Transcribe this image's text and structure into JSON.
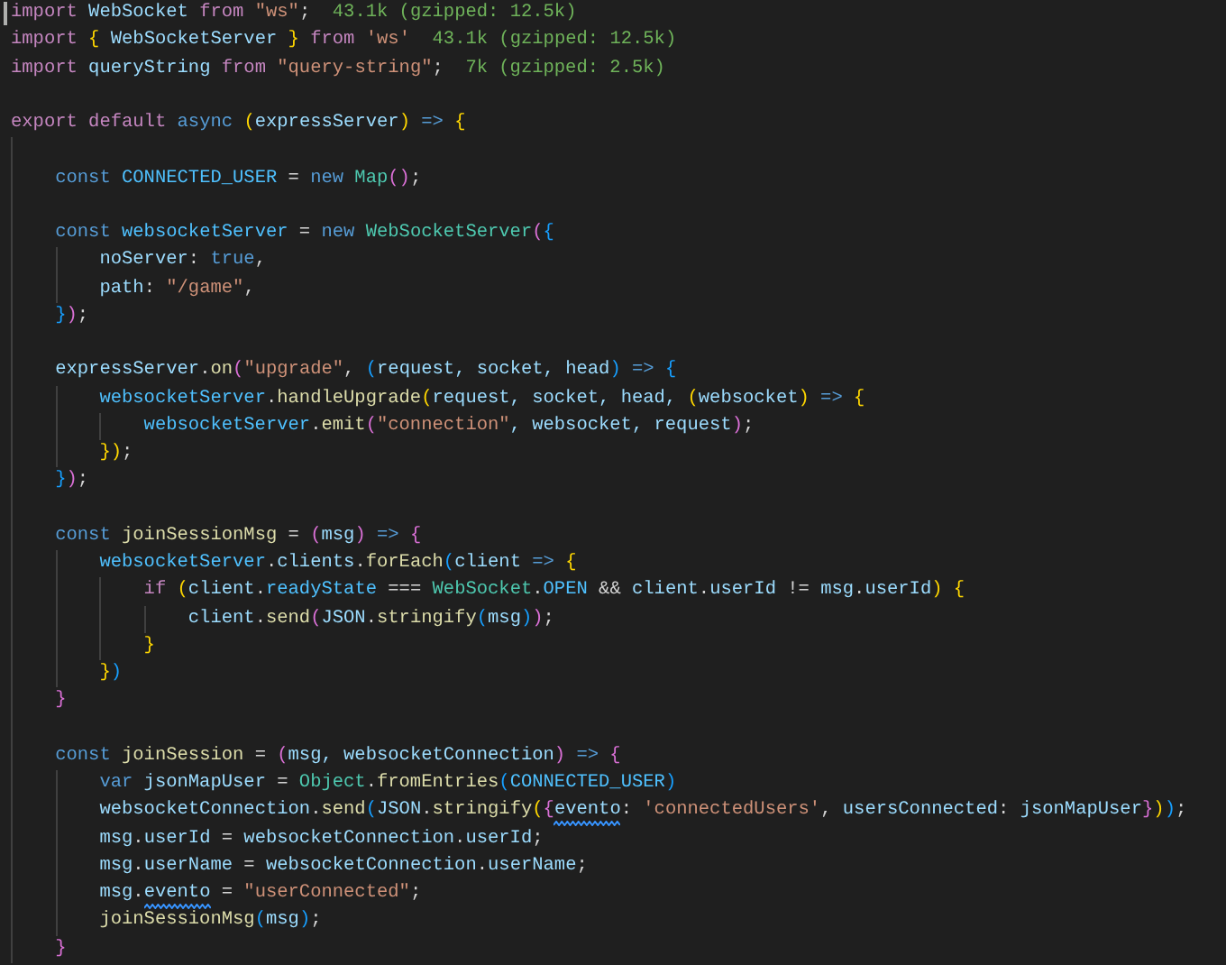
{
  "editor": {
    "cursor_at_start": true,
    "lines": [
      {
        "kind": "code",
        "tokens": [
          {
            "text": "import",
            "kind": "keyword"
          },
          {
            "text": " WebSocket ",
            "kind": "variable"
          },
          {
            "text": "from",
            "kind": "keyword"
          },
          {
            "text": " \"ws\"",
            "kind": "string"
          },
          {
            "text": ";",
            "kind": "plain"
          }
        ],
        "hint": "43.1k (gzipped: 12.5k)"
      },
      {
        "kind": "code",
        "tokens": [
          {
            "text": "import",
            "kind": "keyword"
          },
          {
            "text": " {",
            "kind": "bracket1"
          },
          {
            "text": " WebSocketServer ",
            "kind": "variable"
          },
          {
            "text": "}",
            "kind": "bracket1"
          },
          {
            "text": " from",
            "kind": "keyword"
          },
          {
            "text": " 'ws'",
            "kind": "string"
          }
        ],
        "hint": "43.1k (gzipped: 12.5k)"
      },
      {
        "kind": "code",
        "tokens": [
          {
            "text": "import",
            "kind": "keyword"
          },
          {
            "text": " queryString ",
            "kind": "variable"
          },
          {
            "text": "from",
            "kind": "keyword"
          },
          {
            "text": " \"query-string\"",
            "kind": "string"
          },
          {
            "text": ";",
            "kind": "plain"
          }
        ],
        "hint": "7k (gzipped: 2.5k)"
      },
      {
        "kind": "blank"
      },
      {
        "kind": "code",
        "tokens": [
          {
            "text": "export default",
            "kind": "keyword"
          },
          {
            "text": " async ",
            "kind": "storage"
          },
          {
            "text": "(",
            "kind": "bracket1"
          },
          {
            "text": "expressServer",
            "kind": "variable"
          },
          {
            "text": ")",
            "kind": "bracket1"
          },
          {
            "text": " =>",
            "kind": "storage"
          },
          {
            "text": " {",
            "kind": "bracket1"
          }
        ]
      },
      {
        "kind": "blank"
      },
      {
        "kind": "code",
        "tokens": [
          {
            "text": "    const",
            "kind": "storage"
          },
          {
            "text": " CONNECTED_USER",
            "kind": "constant"
          },
          {
            "text": " = ",
            "kind": "plain"
          },
          {
            "text": "new",
            "kind": "storage"
          },
          {
            "text": " Map",
            "kind": "type"
          },
          {
            "text": "()",
            "kind": "bracket2"
          },
          {
            "text": ";",
            "kind": "plain"
          }
        ]
      },
      {
        "kind": "blank"
      },
      {
        "kind": "code",
        "tokens": [
          {
            "text": "    const",
            "kind": "storage"
          },
          {
            "text": " websocketServer",
            "kind": "constant"
          },
          {
            "text": " = ",
            "kind": "plain"
          },
          {
            "text": "new",
            "kind": "storage"
          },
          {
            "text": " WebSocketServer",
            "kind": "type"
          },
          {
            "text": "(",
            "kind": "bracket2"
          },
          {
            "text": "{",
            "kind": "bracket3"
          }
        ]
      },
      {
        "kind": "code",
        "tokens": [
          {
            "text": "        noServer",
            "kind": "variable"
          },
          {
            "text": ": ",
            "kind": "plain"
          },
          {
            "text": "true",
            "kind": "storage"
          },
          {
            "text": ",",
            "kind": "plain"
          }
        ]
      },
      {
        "kind": "code",
        "tokens": [
          {
            "text": "        path",
            "kind": "variable"
          },
          {
            "text": ": ",
            "kind": "plain"
          },
          {
            "text": "\"/game\"",
            "kind": "string"
          },
          {
            "text": ",",
            "kind": "plain"
          }
        ]
      },
      {
        "kind": "code",
        "tokens": [
          {
            "text": "    }",
            "kind": "bracket3"
          },
          {
            "text": ")",
            "kind": "bracket2"
          },
          {
            "text": ";",
            "kind": "plain"
          }
        ]
      },
      {
        "kind": "blank"
      },
      {
        "kind": "code",
        "tokens": [
          {
            "text": "    expressServer",
            "kind": "variable"
          },
          {
            "text": ".",
            "kind": "plain"
          },
          {
            "text": "on",
            "kind": "function"
          },
          {
            "text": "(",
            "kind": "bracket2"
          },
          {
            "text": "\"upgrade\"",
            "kind": "string"
          },
          {
            "text": ", ",
            "kind": "plain"
          },
          {
            "text": "(",
            "kind": "bracket3"
          },
          {
            "text": "request, socket, head",
            "kind": "variable"
          },
          {
            "text": ")",
            "kind": "bracket3"
          },
          {
            "text": " => ",
            "kind": "storage"
          },
          {
            "text": "{",
            "kind": "bracket3"
          }
        ]
      },
      {
        "kind": "code",
        "tokens": [
          {
            "text": "        websocketServer",
            "kind": "constant"
          },
          {
            "text": ".",
            "kind": "plain"
          },
          {
            "text": "handleUpgrade",
            "kind": "function"
          },
          {
            "text": "(",
            "kind": "bracket1"
          },
          {
            "text": "request, socket, head, ",
            "kind": "variable"
          },
          {
            "text": "(",
            "kind": "bracket1"
          },
          {
            "text": "websocket",
            "kind": "variable"
          },
          {
            "text": ")",
            "kind": "bracket1"
          },
          {
            "text": " => ",
            "kind": "storage"
          },
          {
            "text": "{",
            "kind": "bracket1"
          }
        ]
      },
      {
        "kind": "code",
        "tokens": [
          {
            "text": "            websocketServer",
            "kind": "constant"
          },
          {
            "text": ".",
            "kind": "plain"
          },
          {
            "text": "emit",
            "kind": "function"
          },
          {
            "text": "(",
            "kind": "bracket2"
          },
          {
            "text": "\"connection\"",
            "kind": "string"
          },
          {
            "text": ", websocket, request",
            "kind": "variable"
          },
          {
            "text": ")",
            "kind": "bracket2"
          },
          {
            "text": ";",
            "kind": "plain"
          }
        ]
      },
      {
        "kind": "code",
        "tokens": [
          {
            "text": "        })",
            "kind": "bracket1"
          },
          {
            "text": ";",
            "kind": "plain"
          }
        ]
      },
      {
        "kind": "code",
        "tokens": [
          {
            "text": "    }",
            "kind": "bracket3"
          },
          {
            "text": ")",
            "kind": "bracket2"
          },
          {
            "text": ";",
            "kind": "plain"
          }
        ]
      },
      {
        "kind": "blank"
      },
      {
        "kind": "code",
        "tokens": [
          {
            "text": "    const",
            "kind": "storage"
          },
          {
            "text": " joinSessionMsg",
            "kind": "function"
          },
          {
            "text": " = ",
            "kind": "plain"
          },
          {
            "text": "(",
            "kind": "bracket2"
          },
          {
            "text": "msg",
            "kind": "variable"
          },
          {
            "text": ")",
            "kind": "bracket2"
          },
          {
            "text": " => ",
            "kind": "storage"
          },
          {
            "text": "{",
            "kind": "bracket2"
          }
        ]
      },
      {
        "kind": "code",
        "tokens": [
          {
            "text": "        websocketServer",
            "kind": "constant"
          },
          {
            "text": ".",
            "kind": "plain"
          },
          {
            "text": "clients",
            "kind": "variable"
          },
          {
            "text": ".",
            "kind": "plain"
          },
          {
            "text": "forEach",
            "kind": "function"
          },
          {
            "text": "(",
            "kind": "bracket3"
          },
          {
            "text": "client",
            "kind": "variable"
          },
          {
            "text": " => ",
            "kind": "storage"
          },
          {
            "text": "{",
            "kind": "bracket1"
          }
        ]
      },
      {
        "kind": "code",
        "tokens": [
          {
            "text": "            if",
            "kind": "keyword"
          },
          {
            "text": " (",
            "kind": "bracket1"
          },
          {
            "text": "client",
            "kind": "variable"
          },
          {
            "text": ".",
            "kind": "plain"
          },
          {
            "text": "readyState",
            "kind": "constant"
          },
          {
            "text": " === ",
            "kind": "plain"
          },
          {
            "text": "WebSocket",
            "kind": "type"
          },
          {
            "text": ".",
            "kind": "plain"
          },
          {
            "text": "OPEN",
            "kind": "constant"
          },
          {
            "text": " && ",
            "kind": "plain"
          },
          {
            "text": "client",
            "kind": "variable"
          },
          {
            "text": ".",
            "kind": "plain"
          },
          {
            "text": "userId",
            "kind": "variable"
          },
          {
            "text": " != ",
            "kind": "plain"
          },
          {
            "text": "msg",
            "kind": "variable"
          },
          {
            "text": ".",
            "kind": "plain"
          },
          {
            "text": "userId",
            "kind": "variable"
          },
          {
            "text": ")",
            "kind": "bracket1"
          },
          {
            "text": " {",
            "kind": "bracket1"
          }
        ]
      },
      {
        "kind": "code",
        "tokens": [
          {
            "text": "                client",
            "kind": "variable"
          },
          {
            "text": ".",
            "kind": "plain"
          },
          {
            "text": "send",
            "kind": "function"
          },
          {
            "text": "(",
            "kind": "bracket2"
          },
          {
            "text": "JSON",
            "kind": "variable"
          },
          {
            "text": ".",
            "kind": "plain"
          },
          {
            "text": "stringify",
            "kind": "function"
          },
          {
            "text": "(",
            "kind": "bracket3"
          },
          {
            "text": "msg",
            "kind": "variable"
          },
          {
            "text": ")",
            "kind": "bracket3"
          },
          {
            "text": ")",
            "kind": "bracket2"
          },
          {
            "text": ";",
            "kind": "plain"
          }
        ]
      },
      {
        "kind": "code",
        "tokens": [
          {
            "text": "            }",
            "kind": "bracket1"
          }
        ]
      },
      {
        "kind": "code",
        "tokens": [
          {
            "text": "        }",
            "kind": "bracket1"
          },
          {
            "text": ")",
            "kind": "bracket3"
          }
        ]
      },
      {
        "kind": "code",
        "tokens": [
          {
            "text": "    }",
            "kind": "bracket2"
          }
        ]
      },
      {
        "kind": "blank"
      },
      {
        "kind": "code",
        "tokens": [
          {
            "text": "    const",
            "kind": "storage"
          },
          {
            "text": " joinSession",
            "kind": "function"
          },
          {
            "text": " = ",
            "kind": "plain"
          },
          {
            "text": "(",
            "kind": "bracket2"
          },
          {
            "text": "msg, websocketConnection",
            "kind": "variable"
          },
          {
            "text": ")",
            "kind": "bracket2"
          },
          {
            "text": " => ",
            "kind": "storage"
          },
          {
            "text": "{",
            "kind": "bracket2"
          }
        ]
      },
      {
        "kind": "code",
        "tokens": [
          {
            "text": "        var",
            "kind": "storage"
          },
          {
            "text": " jsonMapUser",
            "kind": "variable"
          },
          {
            "text": " = ",
            "kind": "plain"
          },
          {
            "text": "Object",
            "kind": "type"
          },
          {
            "text": ".",
            "kind": "plain"
          },
          {
            "text": "fromEntries",
            "kind": "function"
          },
          {
            "text": "(",
            "kind": "bracket3"
          },
          {
            "text": "CONNECTED_USER",
            "kind": "constant"
          },
          {
            "text": ")",
            "kind": "bracket3"
          }
        ]
      },
      {
        "kind": "code",
        "tokens": [
          {
            "text": "        websocketConnection",
            "kind": "variable"
          },
          {
            "text": ".",
            "kind": "plain"
          },
          {
            "text": "send",
            "kind": "function"
          },
          {
            "text": "(",
            "kind": "bracket3"
          },
          {
            "text": "JSON",
            "kind": "variable"
          },
          {
            "text": ".",
            "kind": "plain"
          },
          {
            "text": "stringify",
            "kind": "function"
          },
          {
            "text": "(",
            "kind": "bracket1"
          },
          {
            "text": "{",
            "kind": "bracket2"
          },
          {
            "text": "evento",
            "kind": "variable",
            "squiggle": true
          },
          {
            "text": ": ",
            "kind": "plain"
          },
          {
            "text": "'connectedUsers'",
            "kind": "string"
          },
          {
            "text": ", ",
            "kind": "plain"
          },
          {
            "text": "usersConnected",
            "kind": "variable"
          },
          {
            "text": ": ",
            "kind": "plain"
          },
          {
            "text": "jsonMapUser",
            "kind": "variable"
          },
          {
            "text": "}",
            "kind": "bracket2"
          },
          {
            "text": ")",
            "kind": "bracket1"
          },
          {
            "text": ")",
            "kind": "bracket3"
          },
          {
            "text": ";",
            "kind": "plain"
          }
        ]
      },
      {
        "kind": "code",
        "tokens": [
          {
            "text": "        msg",
            "kind": "variable"
          },
          {
            "text": ".",
            "kind": "plain"
          },
          {
            "text": "userId",
            "kind": "variable"
          },
          {
            "text": " = ",
            "kind": "plain"
          },
          {
            "text": "websocketConnection",
            "kind": "variable"
          },
          {
            "text": ".",
            "kind": "plain"
          },
          {
            "text": "userId",
            "kind": "variable"
          },
          {
            "text": ";",
            "kind": "plain"
          }
        ]
      },
      {
        "kind": "code",
        "tokens": [
          {
            "text": "        msg",
            "kind": "variable"
          },
          {
            "text": ".",
            "kind": "plain"
          },
          {
            "text": "userName",
            "kind": "variable"
          },
          {
            "text": " = ",
            "kind": "plain"
          },
          {
            "text": "websocketConnection",
            "kind": "variable"
          },
          {
            "text": ".",
            "kind": "plain"
          },
          {
            "text": "userName",
            "kind": "variable"
          },
          {
            "text": ";",
            "kind": "plain"
          }
        ]
      },
      {
        "kind": "code",
        "tokens": [
          {
            "text": "        msg",
            "kind": "variable"
          },
          {
            "text": ".",
            "kind": "plain"
          },
          {
            "text": "evento",
            "kind": "variable",
            "squiggle": true
          },
          {
            "text": " = ",
            "kind": "plain"
          },
          {
            "text": "\"userConnected\"",
            "kind": "string"
          },
          {
            "text": ";",
            "kind": "plain"
          }
        ]
      },
      {
        "kind": "code",
        "tokens": [
          {
            "text": "        joinSessionMsg",
            "kind": "function"
          },
          {
            "text": "(",
            "kind": "bracket3"
          },
          {
            "text": "msg",
            "kind": "variable"
          },
          {
            "text": ")",
            "kind": "bracket3"
          },
          {
            "text": ";",
            "kind": "plain"
          }
        ]
      },
      {
        "kind": "code",
        "tokens": [
          {
            "text": "    }",
            "kind": "bracket2"
          }
        ]
      }
    ]
  }
}
